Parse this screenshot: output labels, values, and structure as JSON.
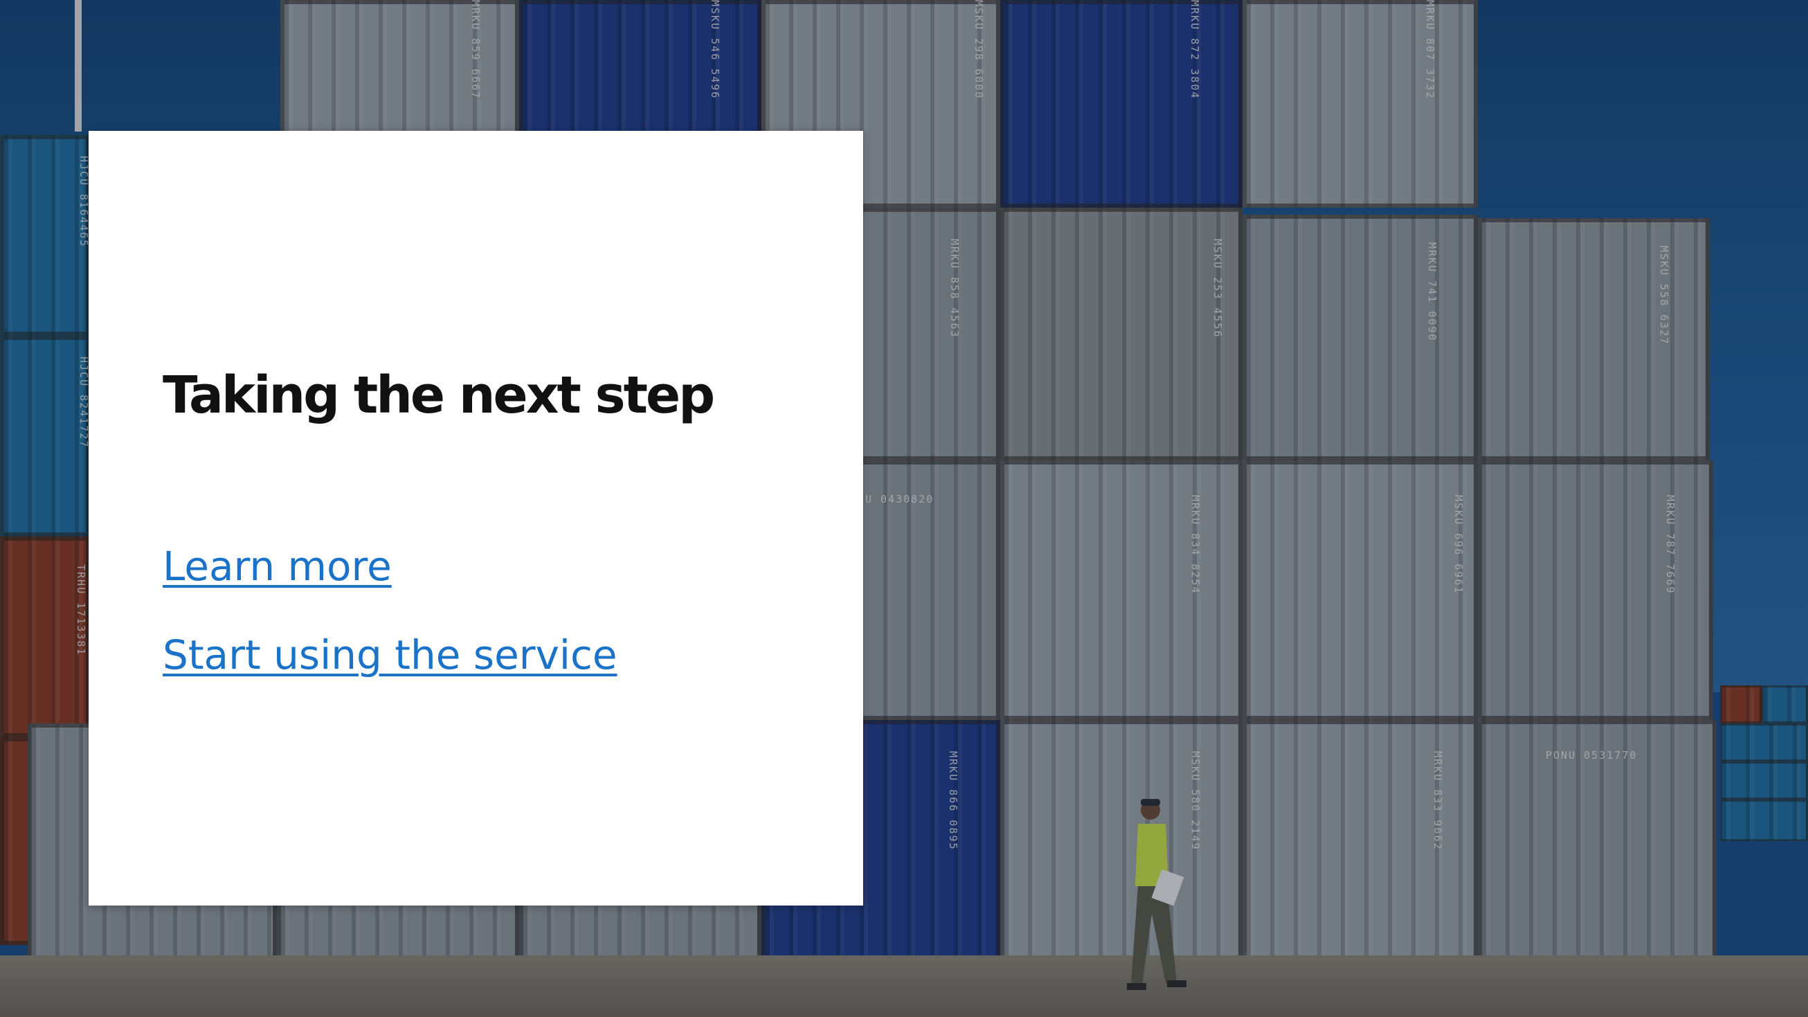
{
  "slide": {
    "title": "Taking the next step",
    "links": [
      {
        "label": "Learn more"
      },
      {
        "label": "Start using the service"
      }
    ]
  },
  "background": {
    "container_codes": [
      "MRKU 859 6667",
      "MSKU 546 5496",
      "MSKU 298 6000",
      "MRKU 872 3804",
      "MRKU 807 3732",
      "MRKU 858 4563",
      "MSKU 253 4556",
      "MRKU 741 0090",
      "MSKU 558 6327",
      "U 0430820",
      "MRKU 834 8254",
      "MSKU 696 6961",
      "MRKU 787 7669",
      "MRKU 866 0895",
      "MSKU 580 2149",
      "MRKU 833 9062",
      "PONU 0531770",
      "HJCU 8164465",
      "HJCU 8241727",
      "TRHU 1713381"
    ]
  },
  "colors": {
    "link": "#1a73c9",
    "title": "#111111",
    "card": "#ffffff"
  }
}
